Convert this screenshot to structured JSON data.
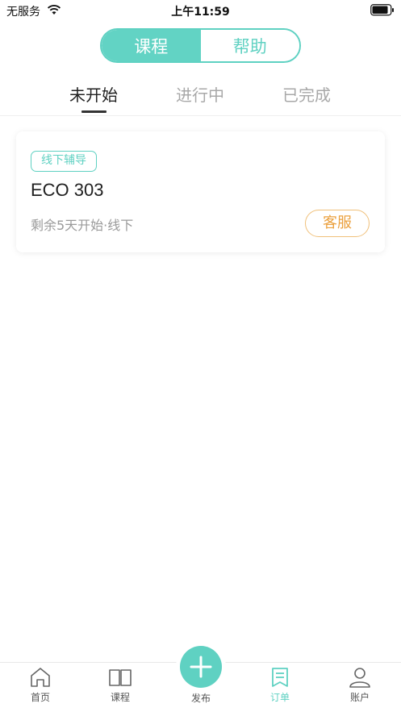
{
  "status_bar": {
    "carrier": "无服务",
    "time": "上午11:59"
  },
  "segment": {
    "left": "课程",
    "right": "帮助",
    "selected": "课程"
  },
  "tabs": [
    {
      "label": "未开始",
      "active": true
    },
    {
      "label": "进行中",
      "active": false
    },
    {
      "label": "已完成",
      "active": false
    }
  ],
  "card": {
    "tag": "线下辅导",
    "title": "ECO 303",
    "meta": "剩余5天开始·线下",
    "action_label": "客服"
  },
  "tabbar": {
    "home": "首页",
    "course": "课程",
    "publish": "发布",
    "order": "订单",
    "account": "账户",
    "active": "订单"
  },
  "colors": {
    "accent": "#5fd1c2",
    "action": "#eba13f"
  }
}
